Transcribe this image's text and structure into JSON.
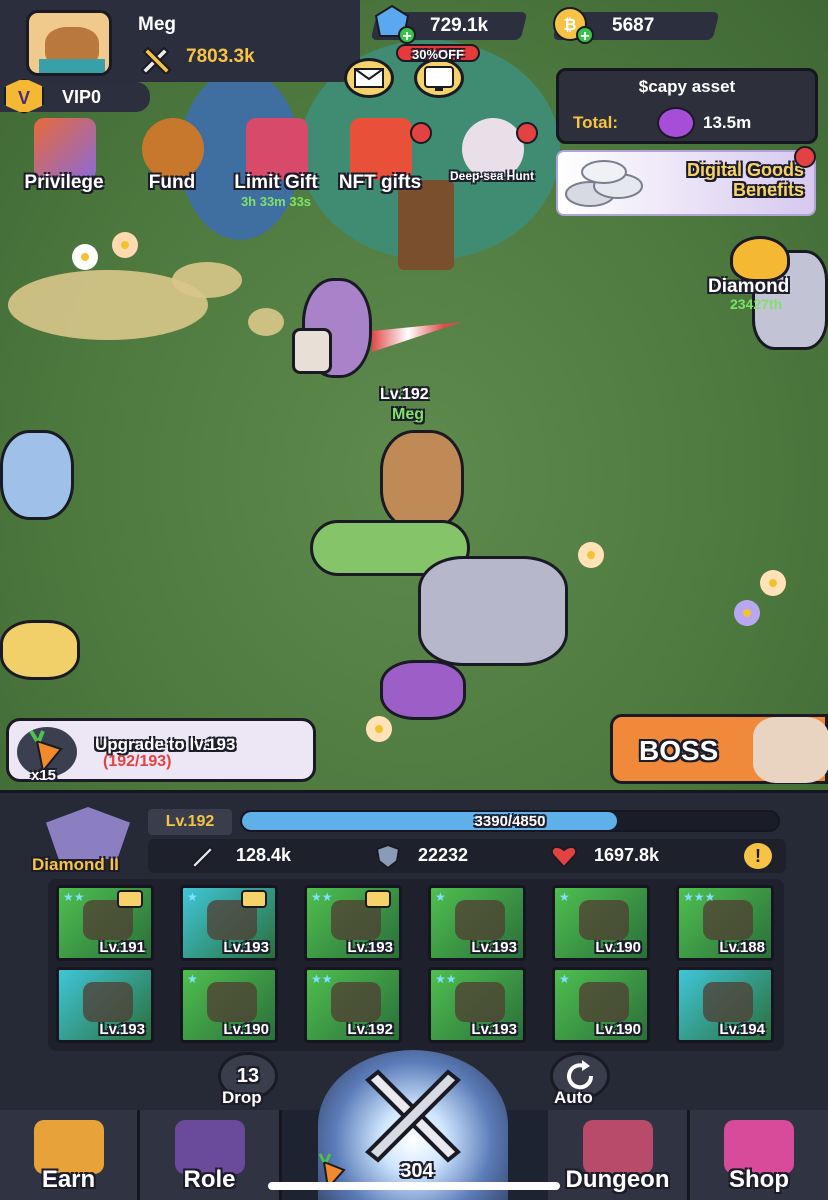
{
  "player": {
    "name": "Meg",
    "power": "7803.3k",
    "vip": "VIP0",
    "vip_badge": "V"
  },
  "currencies": {
    "gems": "729.1k",
    "coins": "5687"
  },
  "top_buttons": {
    "discount": "30%OFF"
  },
  "asset": {
    "title": "$capy asset",
    "total_label": "Total:",
    "total_value": "13.5m"
  },
  "events": [
    {
      "label": "Privilege",
      "sub": ""
    },
    {
      "label": "Fund",
      "sub": ""
    },
    {
      "label": "Limit Gift",
      "sub": "3h 33m 33s"
    },
    {
      "label": "NFT gifts",
      "sub": ""
    },
    {
      "label": "Deep-sea Hunt",
      "sub": ""
    }
  ],
  "digital_goods": {
    "line1": "Digital Goods",
    "line2": "Benefits"
  },
  "ranking": {
    "name": "Diamond",
    "position": "23427th"
  },
  "hero": {
    "level": "Lv.192",
    "name": "Meg"
  },
  "upgrade": {
    "title": "Upgrade to lv.193",
    "progress": "(192/193)",
    "multiplier": "x15"
  },
  "boss": {
    "label": "BOSS"
  },
  "stats": {
    "rank_title": "Diamond II",
    "level": "Lv.192",
    "xp_text": "3390/4850",
    "xp_current": 3390,
    "xp_max": 4850,
    "attack": "128.4k",
    "defense": "22232",
    "hp": "1697.8k",
    "info": "!"
  },
  "equipment": [
    {
      "level": "Lv.191",
      "stars": "★★",
      "heart": true,
      "color": "#4fbf4f",
      "item": "hammer-icon"
    },
    {
      "level": "Lv.193",
      "stars": "★",
      "heart": true,
      "color": "#3fc6d8",
      "item": "hood-icon"
    },
    {
      "level": "Lv.193",
      "stars": "★★",
      "heart": true,
      "color": "#4fbf4f",
      "item": "skirt-icon"
    },
    {
      "level": "Lv.193",
      "stars": "★",
      "heart": false,
      "color": "#4fbf4f",
      "item": "gauntlet-icon"
    },
    {
      "level": "Lv.190",
      "stars": "★",
      "heart": false,
      "color": "#4fbf4f",
      "item": "boomerang-icon"
    },
    {
      "level": "Lv.188",
      "stars": "★★★",
      "heart": false,
      "color": "#4fbf4f",
      "item": "ring-icon"
    },
    {
      "level": "Lv.193",
      "stars": "",
      "heart": false,
      "color": "#3fc6d8",
      "item": "bag-icon"
    },
    {
      "level": "Lv.190",
      "stars": "★",
      "heart": false,
      "color": "#4fbf4f",
      "item": "talisman-icon"
    },
    {
      "level": "Lv.192",
      "stars": "★★",
      "heart": false,
      "color": "#4fbf4f",
      "item": "belt-icon"
    },
    {
      "level": "Lv.193",
      "stars": "★★",
      "heart": false,
      "color": "#4fbf4f",
      "item": "armor-icon"
    },
    {
      "level": "Lv.190",
      "stars": "★",
      "heart": false,
      "color": "#4fbf4f",
      "item": "boots-icon"
    },
    {
      "level": "Lv.194",
      "stars": "",
      "heart": false,
      "color": "#3fc6d8",
      "item": "helmet-icon"
    }
  ],
  "controls": {
    "drop_count": "13",
    "drop_label": "Drop",
    "auto_label": "Auto",
    "fight_count": "304"
  },
  "nav": {
    "earn": "Earn",
    "role": "Role",
    "dungeon": "Dungeon",
    "shop": "Shop"
  },
  "colors": {
    "accent_gold": "#f6c344",
    "level_green": "#7fe06a",
    "alert_red": "#e24242",
    "xp_blue": "#5fb0e8"
  }
}
